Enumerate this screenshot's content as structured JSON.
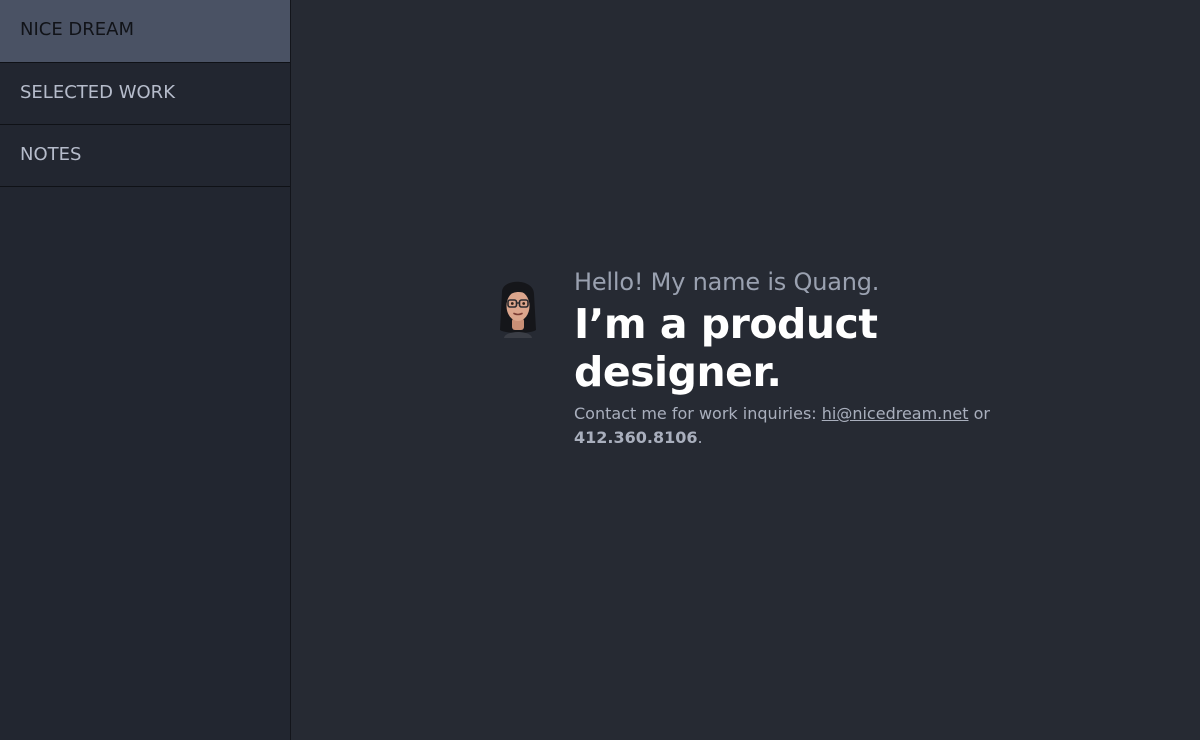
{
  "sidebar": {
    "items": [
      {
        "label": "NICE DREAM"
      },
      {
        "label": "SELECTED WORK"
      },
      {
        "label": "NOTES"
      }
    ]
  },
  "intro": {
    "hello": "Hello! My name is Quang.",
    "headline": "I’m a product designer.",
    "contact_prefix": "Contact me for work inquiries: ",
    "email": "hi@nicedream.net",
    "contact_mid": " or",
    "phone": "412.360.8106",
    "contact_suffix": "."
  },
  "colors": {
    "background": "#262a33",
    "sidebar": "#222630",
    "active_item": "#4a5264"
  }
}
